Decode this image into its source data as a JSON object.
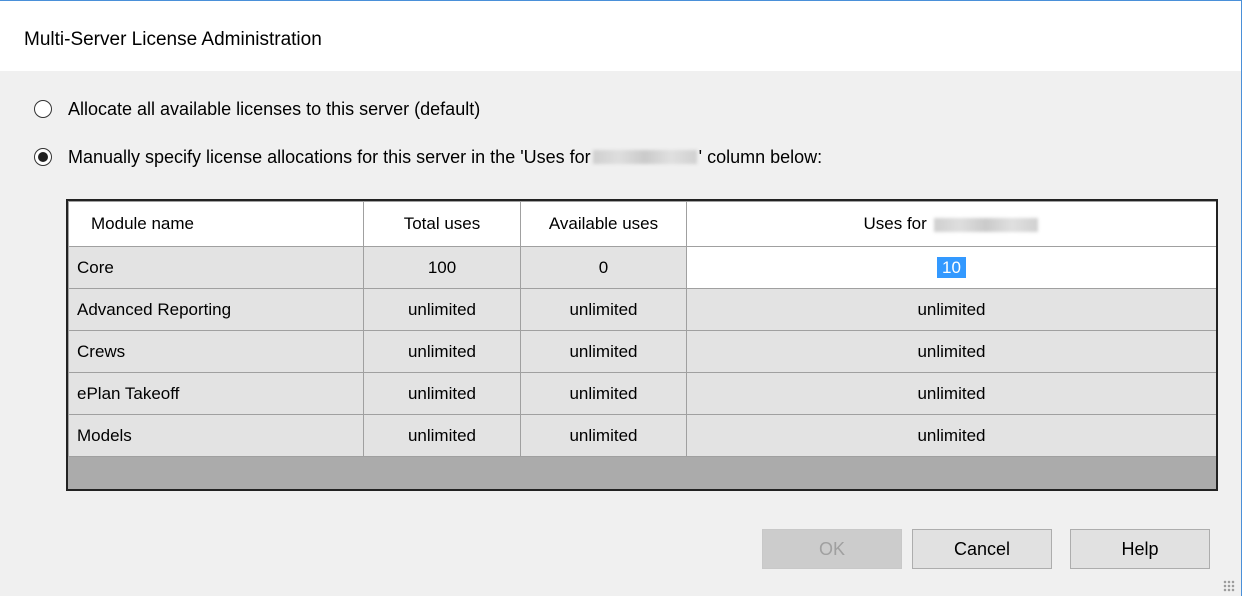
{
  "window": {
    "title": "Multi-Server License Administration"
  },
  "options": {
    "allocate_all": {
      "label": "Allocate all available licenses to this server (default)",
      "checked": false
    },
    "manual": {
      "label_before": "Manually specify license allocations for this server in the 'Uses for ",
      "label_after": "' column below:",
      "checked": true
    }
  },
  "grid": {
    "headers": [
      "Module name",
      "Total uses",
      "Available uses",
      "Uses for "
    ],
    "rows": [
      {
        "module": "Core",
        "total": "100",
        "available": "0",
        "uses": "10"
      },
      {
        "module": "Advanced Reporting",
        "total": "unlimited",
        "available": "unlimited",
        "uses": "unlimited"
      },
      {
        "module": "Crews",
        "total": "unlimited",
        "available": "unlimited",
        "uses": "unlimited"
      },
      {
        "module": "ePlan Takeoff",
        "total": "unlimited",
        "available": "unlimited",
        "uses": "unlimited"
      },
      {
        "module": "Models",
        "total": "unlimited",
        "available": "unlimited",
        "uses": "unlimited"
      }
    ]
  },
  "buttons": {
    "ok": "OK",
    "cancel": "Cancel",
    "help": "Help"
  },
  "colors": {
    "selection": "#3399ff",
    "accent_border": "#4a90d9"
  }
}
